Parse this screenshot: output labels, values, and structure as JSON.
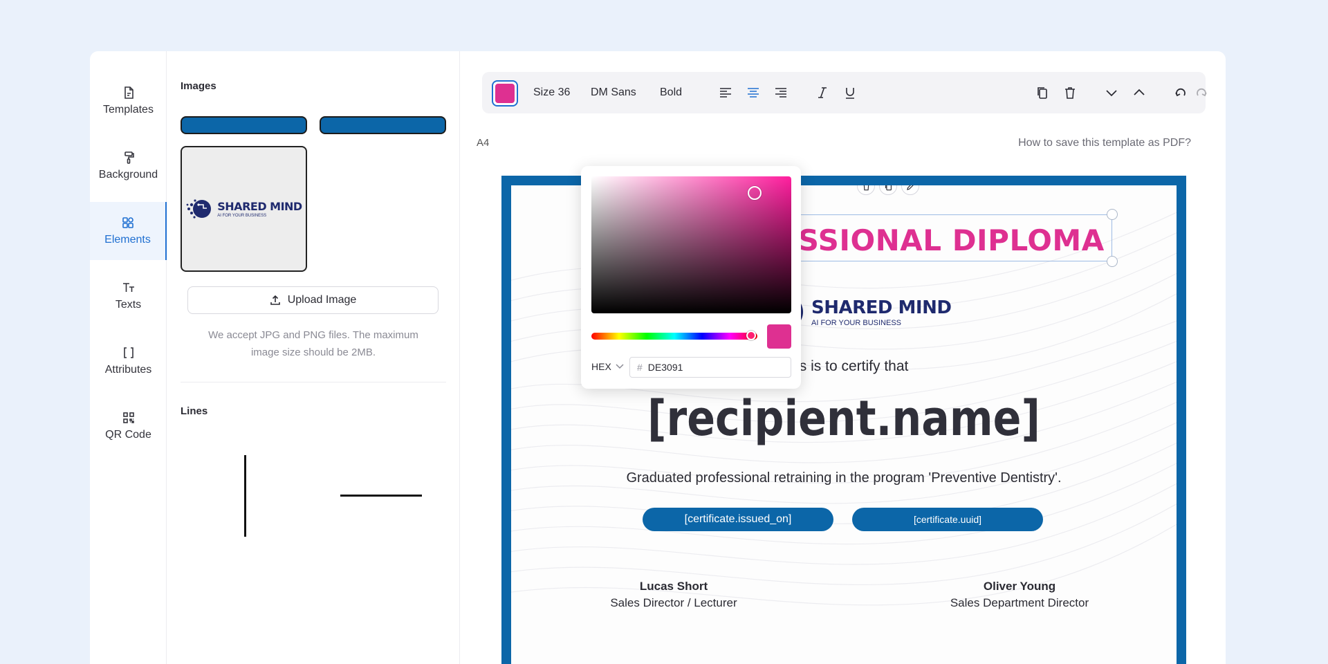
{
  "nav": {
    "items": [
      {
        "label": "Templates",
        "icon": "file-icon"
      },
      {
        "label": "Background",
        "icon": "paint-roller-icon"
      },
      {
        "label": "Elements",
        "icon": "elements-icon",
        "active": true
      },
      {
        "label": "Texts",
        "icon": "text-size-icon"
      },
      {
        "label": "Attributes",
        "icon": "brackets-icon"
      },
      {
        "label": "QR Code",
        "icon": "qr-code-icon"
      }
    ]
  },
  "panel": {
    "images_title": "Images",
    "upload_label": "Upload Image",
    "upload_hint": "We accept JPG and PNG files. The maximum image size should be 2MB.",
    "lines_title": "Lines"
  },
  "logo": {
    "name": "SHARED MIND",
    "tagline": "AI FOR YOUR BUSINESS"
  },
  "toolbar": {
    "size_label": "Size 36",
    "font_label": "DM Sans",
    "weight_label": "Bold",
    "active_color": "#DE3091"
  },
  "editor": {
    "page_format": "A4",
    "howto_link": "How to save this template as PDF?"
  },
  "certificate": {
    "title": "PROFESSIONAL DIPLOMA",
    "certify_text": "This is to certify that",
    "recipient": "[recipient.name]",
    "program": "Graduated professional retraining in the program 'Preventive Dentistry'.",
    "issued_on": "[certificate.issued_on]",
    "uuid": "[certificate.uuid]",
    "signer1_name": "Lucas Short",
    "signer1_role": "Sales Director / Lecturer",
    "signer2_name": "Oliver Young",
    "signer2_role": "Sales Department Director",
    "frame_color": "#0C66A8"
  },
  "picker": {
    "mode": "HEX",
    "hash": "#",
    "hex_value": "DE3091"
  }
}
